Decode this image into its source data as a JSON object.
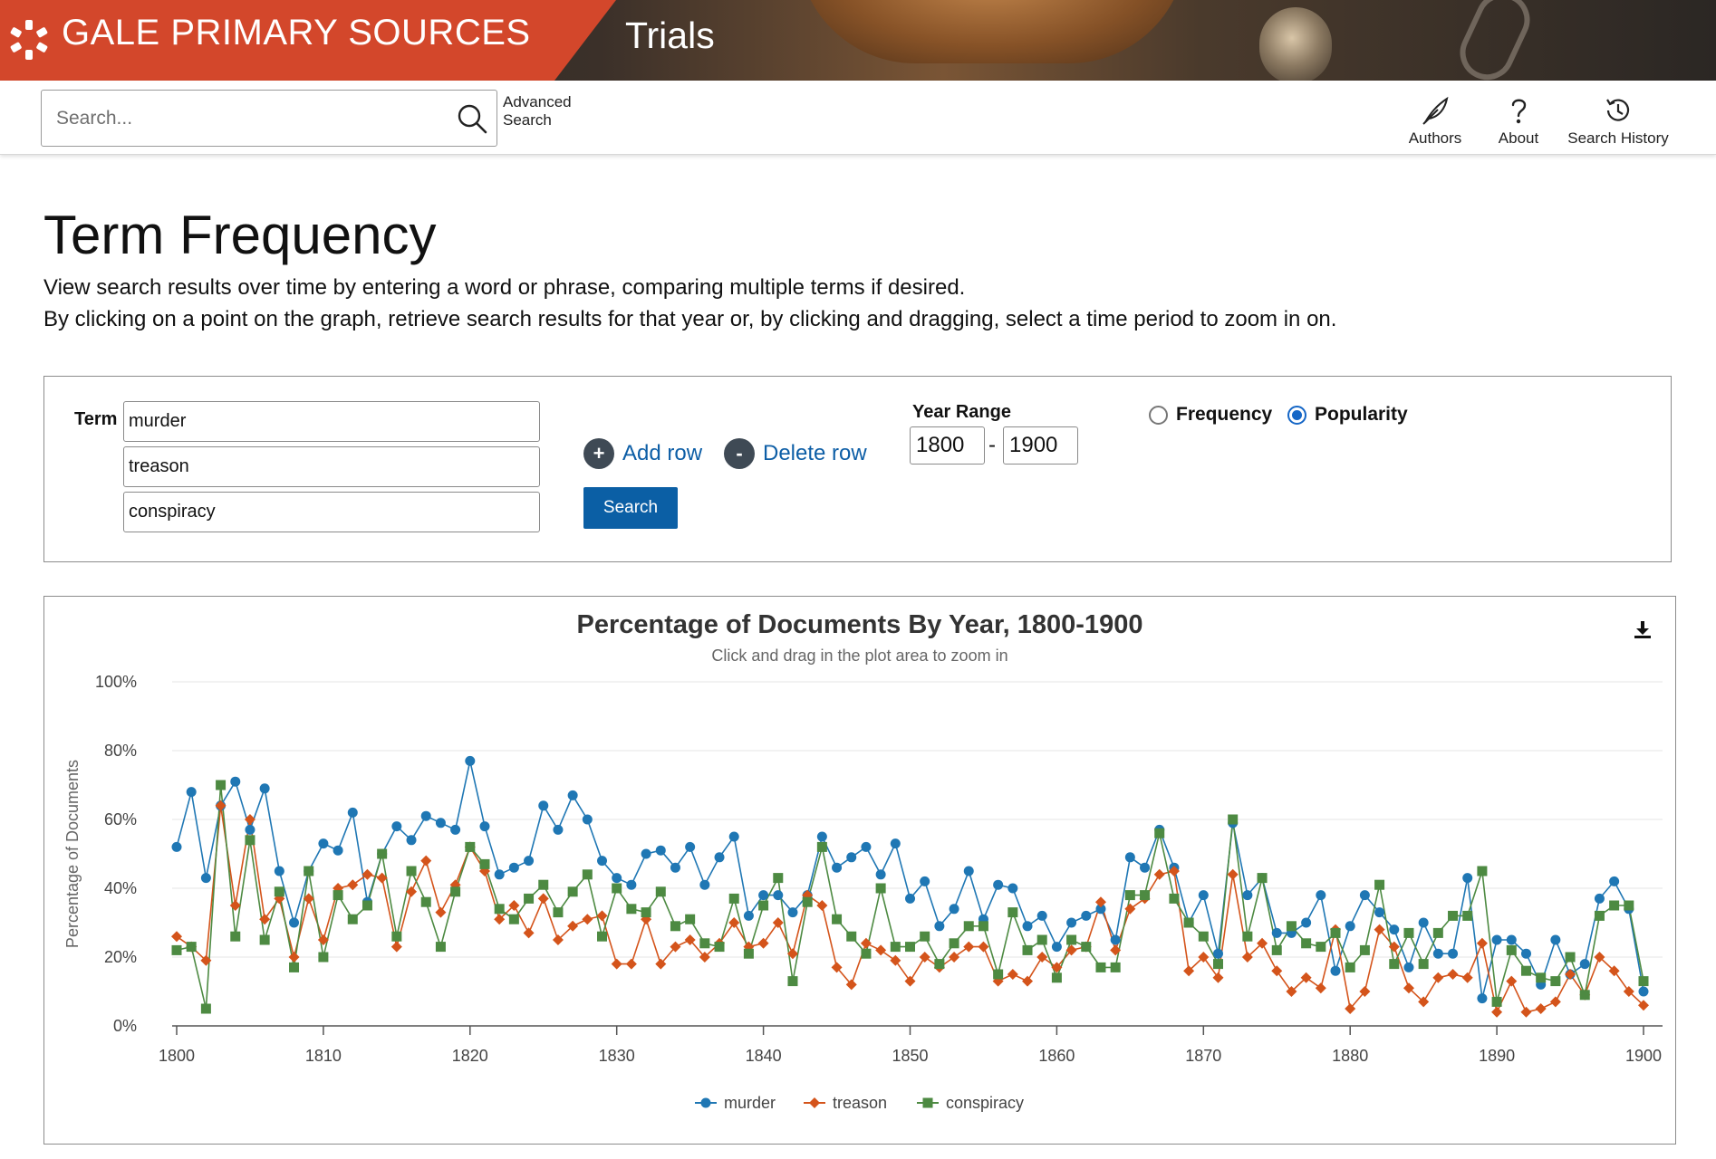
{
  "header": {
    "brand": "GALE PRIMARY SOURCES",
    "collection": "Trials",
    "brand_color": "#d3472b"
  },
  "search": {
    "placeholder": "Search...",
    "advanced_line1": "Advanced",
    "advanced_line2": "Search"
  },
  "utilities": [
    {
      "label": "Authors",
      "icon": "feather-icon"
    },
    {
      "label": "About",
      "icon": "question-icon"
    },
    {
      "label": "Search History",
      "icon": "history-icon"
    }
  ],
  "page": {
    "title": "Term Frequency",
    "intro1": "View search results over time by entering a word or phrase, comparing multiple terms if desired.",
    "intro2": "By clicking on a point on the graph, retrieve search results for that year or, by clicking and dragging, select a time period to zoom in on."
  },
  "form": {
    "term_label": "Term",
    "terms": [
      "murder",
      "treason",
      "conspiracy"
    ],
    "add_row": "Add row",
    "delete_row": "Delete row",
    "add_symbol": "+",
    "delete_symbol": "-",
    "search_button": "Search",
    "year_range_label": "Year Range",
    "year_from": "1800",
    "year_to": "1900",
    "year_dash": "-",
    "mode_frequency": "Frequency",
    "mode_popularity": "Popularity",
    "selected_mode": "Popularity",
    "button_color": "#0b5fa5"
  },
  "chart_data": {
    "type": "line",
    "title": "Percentage of Documents By Year, 1800-1900",
    "subtitle": "Click and drag in the plot area to zoom in",
    "ylabel": "Percentage of Documents",
    "xlabel": "",
    "ylim": [
      0,
      100
    ],
    "xlim": [
      1800,
      1900
    ],
    "yticks": [
      "0%",
      "20%",
      "40%",
      "60%",
      "80%",
      "100%"
    ],
    "xticks": [
      "1800",
      "1810",
      "1820",
      "1830",
      "1840",
      "1850",
      "1860",
      "1870",
      "1880",
      "1890",
      "1900"
    ],
    "grid": true,
    "legend": "bottom-center",
    "x": [
      1800,
      1801,
      1802,
      1803,
      1804,
      1805,
      1806,
      1807,
      1808,
      1809,
      1810,
      1811,
      1812,
      1813,
      1814,
      1815,
      1816,
      1817,
      1818,
      1819,
      1820,
      1821,
      1822,
      1823,
      1824,
      1825,
      1826,
      1827,
      1828,
      1829,
      1830,
      1831,
      1832,
      1833,
      1834,
      1835,
      1836,
      1837,
      1838,
      1839,
      1840,
      1841,
      1842,
      1843,
      1844,
      1845,
      1846,
      1847,
      1848,
      1849,
      1850,
      1851,
      1852,
      1853,
      1854,
      1855,
      1856,
      1857,
      1858,
      1859,
      1860,
      1861,
      1862,
      1863,
      1864,
      1865,
      1866,
      1867,
      1868,
      1869,
      1870,
      1871,
      1872,
      1873,
      1874,
      1875,
      1876,
      1877,
      1878,
      1879,
      1880,
      1881,
      1882,
      1883,
      1884,
      1885,
      1886,
      1887,
      1888,
      1889,
      1890,
      1891,
      1892,
      1893,
      1894,
      1895,
      1896,
      1897,
      1898,
      1899,
      1900
    ],
    "series": [
      {
        "name": "murder",
        "color": "#1f77b4",
        "marker": "circle",
        "values": [
          52,
          68,
          43,
          64,
          71,
          57,
          69,
          45,
          30,
          45,
          53,
          51,
          62,
          36,
          50,
          58,
          54,
          61,
          59,
          57,
          77,
          58,
          44,
          46,
          48,
          64,
          57,
          67,
          60,
          48,
          43,
          41,
          50,
          51,
          46,
          52,
          41,
          49,
          55,
          32,
          38,
          38,
          33,
          38,
          55,
          46,
          49,
          52,
          44,
          53,
          37,
          42,
          29,
          34,
          45,
          31,
          41,
          40,
          29,
          32,
          23,
          30,
          32,
          34,
          25,
          49,
          46,
          57,
          46,
          30,
          38,
          21,
          59,
          38,
          43,
          27,
          27,
          30,
          38,
          16,
          29,
          38,
          33,
          28,
          17,
          30,
          21,
          21,
          43,
          8,
          25,
          25,
          21,
          12,
          25,
          15,
          18,
          37,
          42,
          34,
          10
        ]
      },
      {
        "name": "treason",
        "color": "#d4541b",
        "marker": "diamond",
        "values": [
          26,
          23,
          19,
          64,
          35,
          60,
          31,
          37,
          20,
          37,
          25,
          40,
          41,
          44,
          43,
          23,
          39,
          48,
          33,
          41,
          52,
          45,
          31,
          35,
          27,
          37,
          25,
          29,
          31,
          32,
          18,
          18,
          31,
          18,
          23,
          25,
          20,
          24,
          30,
          23,
          24,
          30,
          21,
          38,
          35,
          17,
          12,
          24,
          22,
          19,
          13,
          20,
          17,
          20,
          23,
          23,
          13,
          15,
          13,
          20,
          17,
          22,
          23,
          36,
          22,
          34,
          37,
          44,
          45,
          16,
          20,
          14,
          44,
          20,
          24,
          16,
          10,
          14,
          11,
          28,
          5,
          10,
          28,
          23,
          11,
          7,
          14,
          15,
          14,
          24,
          4,
          13,
          4,
          5,
          7,
          15,
          9,
          20,
          16,
          10,
          6
        ]
      },
      {
        "name": "conspiracy",
        "color": "#4d8a42",
        "marker": "square",
        "values": [
          22,
          23,
          5,
          70,
          26,
          54,
          25,
          39,
          17,
          45,
          20,
          38,
          31,
          35,
          50,
          26,
          45,
          36,
          23,
          39,
          52,
          47,
          34,
          31,
          37,
          41,
          33,
          39,
          44,
          26,
          40,
          34,
          33,
          39,
          29,
          31,
          24,
          23,
          37,
          21,
          35,
          43,
          13,
          36,
          52,
          31,
          26,
          21,
          40,
          23,
          23,
          26,
          18,
          24,
          29,
          29,
          15,
          33,
          22,
          25,
          14,
          25,
          23,
          17,
          17,
          38,
          38,
          56,
          37,
          30,
          26,
          18,
          60,
          26,
          43,
          22,
          29,
          24,
          23,
          27,
          17,
          22,
          41,
          18,
          27,
          18,
          27,
          32,
          32,
          45,
          7,
          22,
          16,
          14,
          13,
          20,
          9,
          32,
          35,
          35,
          13
        ]
      }
    ]
  }
}
